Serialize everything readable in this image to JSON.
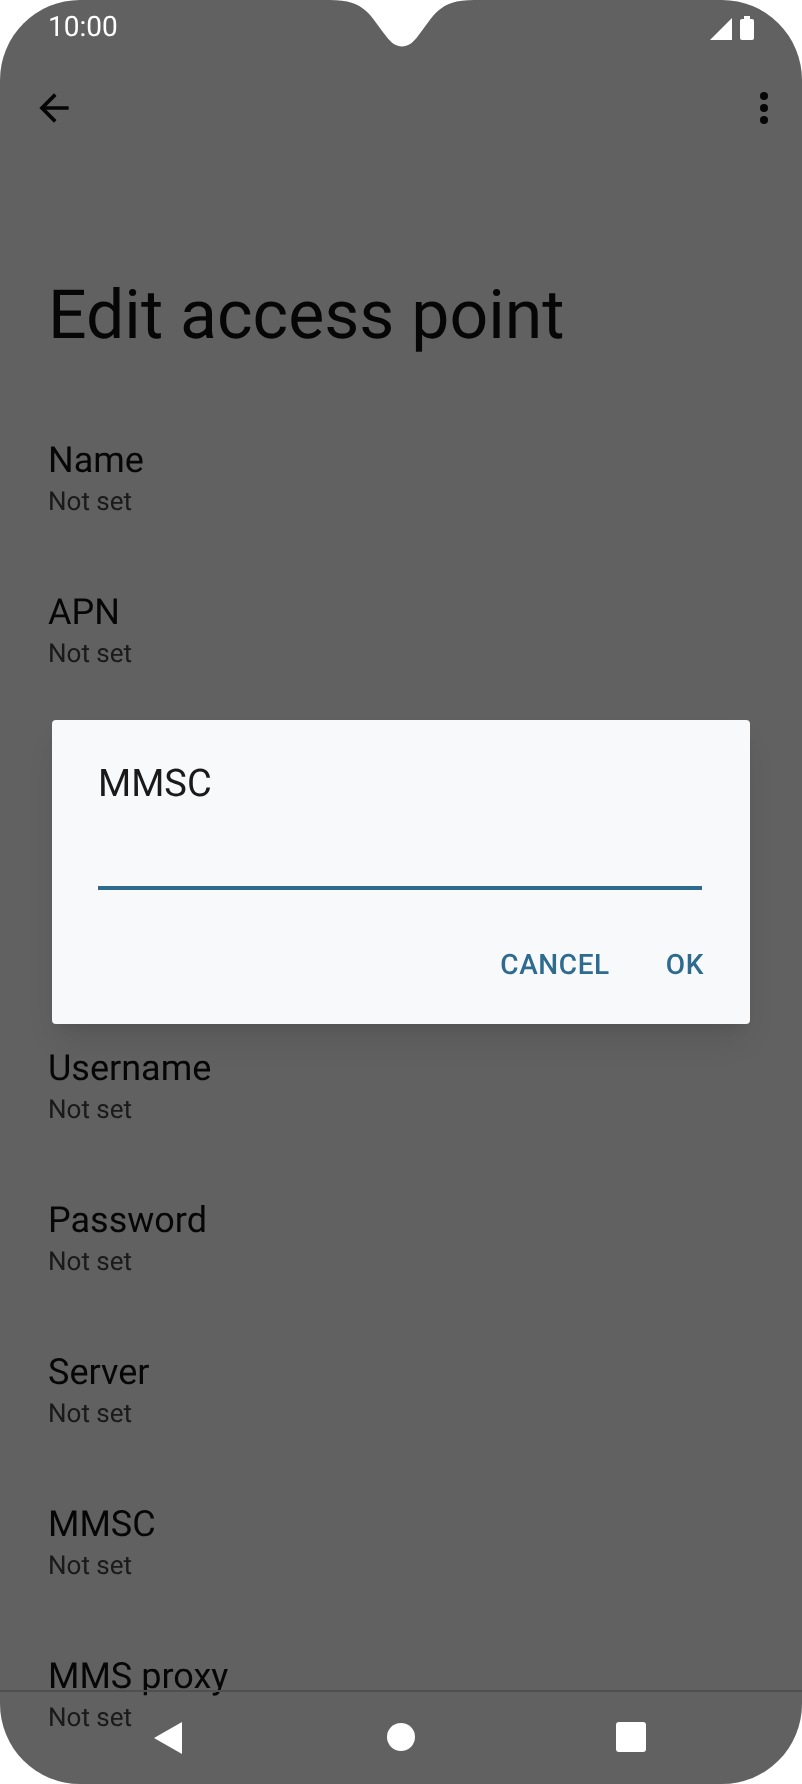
{
  "status_bar": {
    "time": "10:00"
  },
  "toolbar": {
    "title": "Edit access point"
  },
  "settings_above_dialog": [
    {
      "title": "Name",
      "summary": "Not set"
    },
    {
      "title": "APN",
      "summary": "Not set"
    }
  ],
  "settings_below_dialog": [
    {
      "title": "Username",
      "summary": "Not set"
    },
    {
      "title": "Password",
      "summary": "Not set"
    },
    {
      "title": "Server",
      "summary": "Not set"
    },
    {
      "title": "MMSC",
      "summary": "Not set"
    },
    {
      "title": "MMS proxy",
      "summary": "Not set"
    }
  ],
  "dialog": {
    "title": "MMSC",
    "buttons": [
      "CANCEL",
      "OK"
    ]
  }
}
